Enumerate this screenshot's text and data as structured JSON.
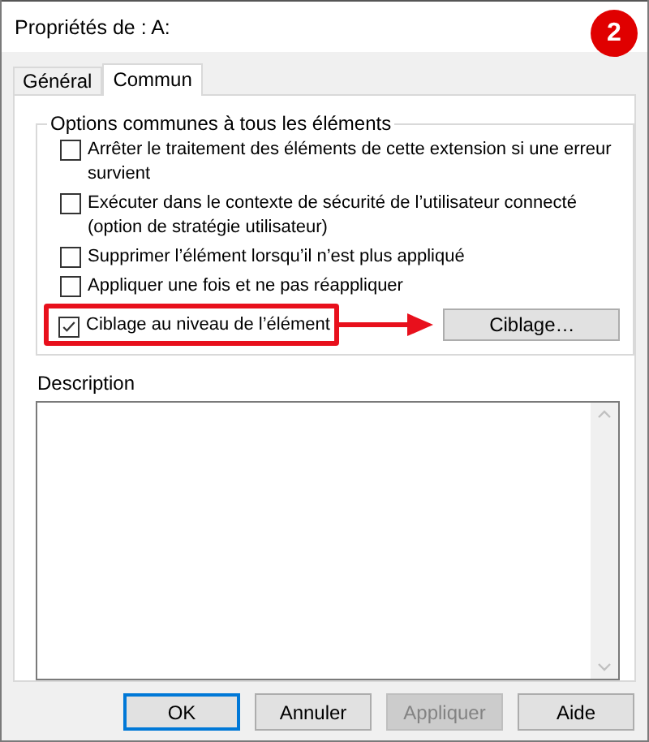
{
  "window": {
    "title": "Propriétés de : A:"
  },
  "step_badge": "2",
  "tabs": [
    {
      "label": "Général",
      "selected": false
    },
    {
      "label": "Commun",
      "selected": true
    }
  ],
  "options_group": {
    "title": "Options communes à tous les éléments",
    "options": [
      {
        "label": "Arrêter le traitement des éléments de cette extension si une erreur survient",
        "checked": false,
        "highlighted": false
      },
      {
        "label": "Exécuter dans le contexte de sécurité de l’utilisateur connecté (option de stratégie utilisateur)",
        "checked": false,
        "highlighted": false
      },
      {
        "label": "Supprimer l’élément lorsqu’il n’est plus appliqué",
        "checked": false,
        "highlighted": false
      },
      {
        "label": "Appliquer une fois et ne pas réappliquer",
        "checked": false,
        "highlighted": false
      },
      {
        "label": "Ciblage au niveau de l’élément",
        "checked": true,
        "highlighted": true,
        "button": "Ciblage…"
      }
    ]
  },
  "description": {
    "label": "Description"
  },
  "buttons": [
    {
      "label": "OK",
      "focused": true,
      "disabled": false
    },
    {
      "label": "Annuler",
      "focused": false,
      "disabled": false
    },
    {
      "label": "Appliquer",
      "focused": false,
      "disabled": true
    },
    {
      "label": "Aide",
      "focused": false,
      "disabled": false
    }
  ]
}
